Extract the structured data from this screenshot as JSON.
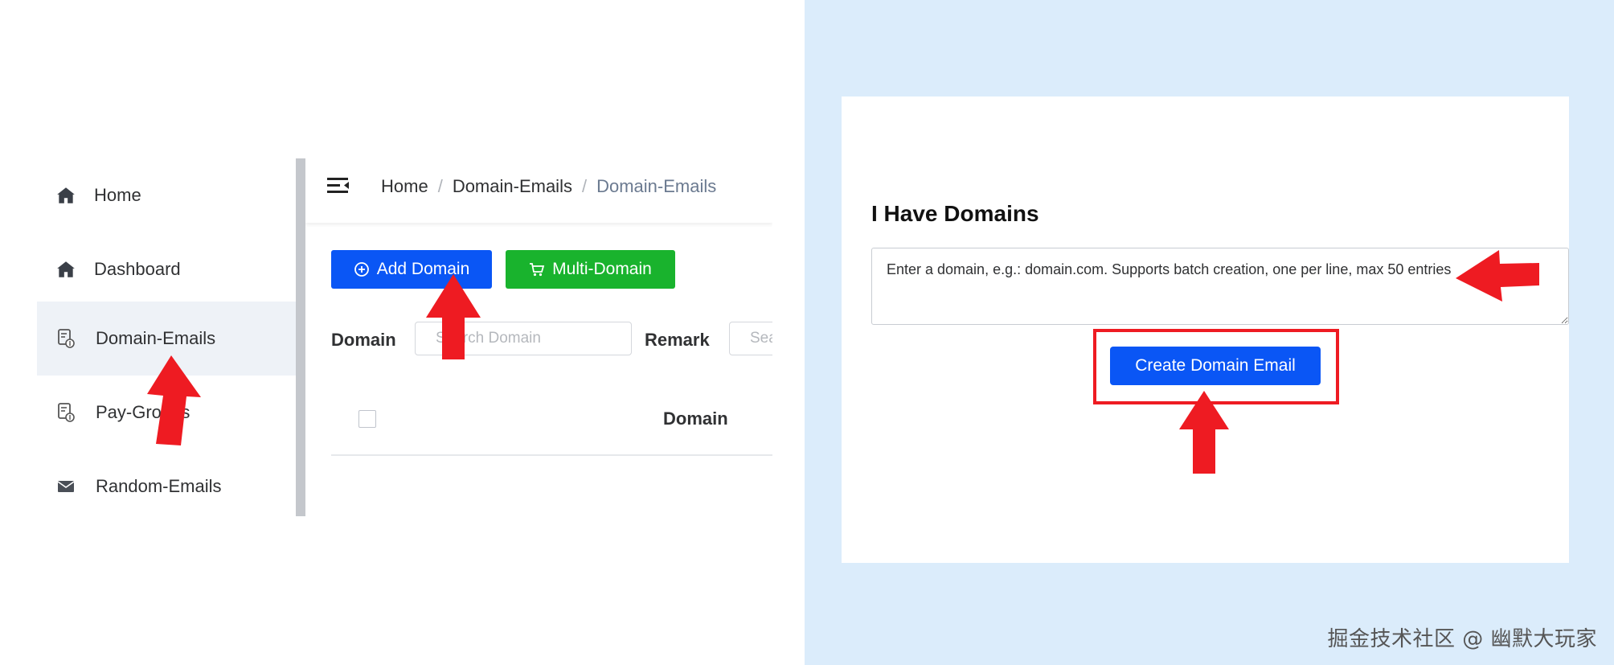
{
  "sidebar": {
    "items": [
      {
        "label": "Home",
        "icon": "home-icon"
      },
      {
        "label": "Dashboard",
        "icon": "home-icon"
      },
      {
        "label": "Domain-Emails",
        "icon": "document-icon",
        "active": true
      },
      {
        "label": "Pay-Groups",
        "icon": "document-icon"
      },
      {
        "label": "Random-Emails",
        "icon": "mail-icon"
      }
    ]
  },
  "topbar": {
    "breadcrumb": [
      "Home",
      "Domain-Emails",
      "Domain-Emails"
    ],
    "separator": "/"
  },
  "toolbar": {
    "add_domain_label": "Add Domain",
    "multi_domain_label": "Multi-Domain"
  },
  "filters": {
    "domain_label": "Domain",
    "domain_placeholder": "Search Domain",
    "remark_label": "Remark",
    "remark_placeholder": "Search Remark"
  },
  "table": {
    "columns": [
      "Domain"
    ]
  },
  "domain_form": {
    "title": "I Have Domains",
    "textarea_placeholder": "Enter a domain, e.g.: domain.com. Supports batch creation, one per line, max 50 entries",
    "create_button_label": "Create Domain Email"
  },
  "watermark": "掘金技术社区 @ 幽默大玩家",
  "colors": {
    "primary": "#0a56f5",
    "success": "#19b32d",
    "annotation": "#ee1b22",
    "right_background": "#dbecfb"
  }
}
